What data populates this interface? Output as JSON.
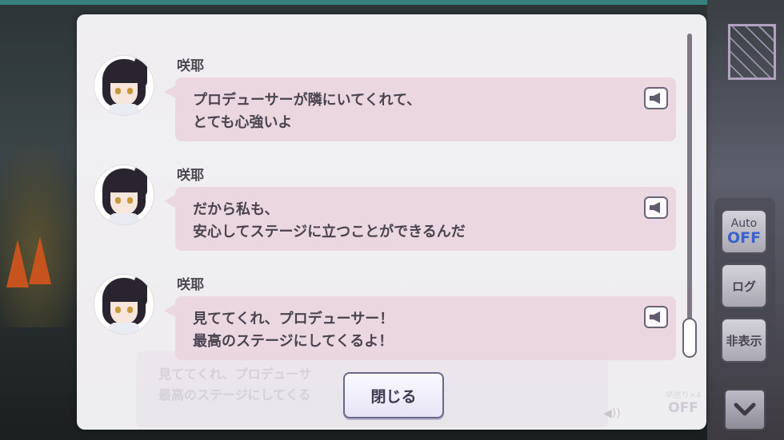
{
  "log_entries": [
    {
      "speaker": "咲耶",
      "lines": [
        "プロデューサーが隣にいてくれて、",
        "とても心強いよ"
      ]
    },
    {
      "speaker": "咲耶",
      "lines": [
        "だから私も、",
        "安心してステージに立つことができるんだ"
      ]
    },
    {
      "speaker": "咲耶",
      "lines": [
        "見ててくれ、プロデューサー！",
        "最高のステージにしてくるよ！"
      ]
    }
  ],
  "close_label": "閉じる",
  "side_menu": {
    "auto_label": "Auto",
    "auto_state": "OFF",
    "log_label": "ログ",
    "hide_label": "非表示"
  },
  "background_text": {
    "lines": [
      "見ててくれ、プロデューサ",
      "最高のステージにしてくる"
    ],
    "speed_label": "早送り×4",
    "speed_state": "OFF"
  },
  "colors": {
    "bubble": "#ebd7df",
    "auto_off": "#3b62c8"
  }
}
